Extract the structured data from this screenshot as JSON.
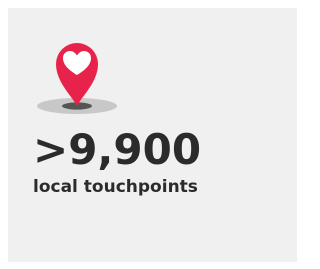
{
  "stat": {
    "value": ">9,900",
    "label": "local touchpoints",
    "icon": "heart-map-pin-icon"
  },
  "colors": {
    "card_background": "#f0f0f0",
    "pin_red": "#e8234b",
    "heart_white": "#ffffff",
    "shadow_outer": "#c8c8c8",
    "shadow_inner": "#555555",
    "text": "#2b2b2b"
  }
}
